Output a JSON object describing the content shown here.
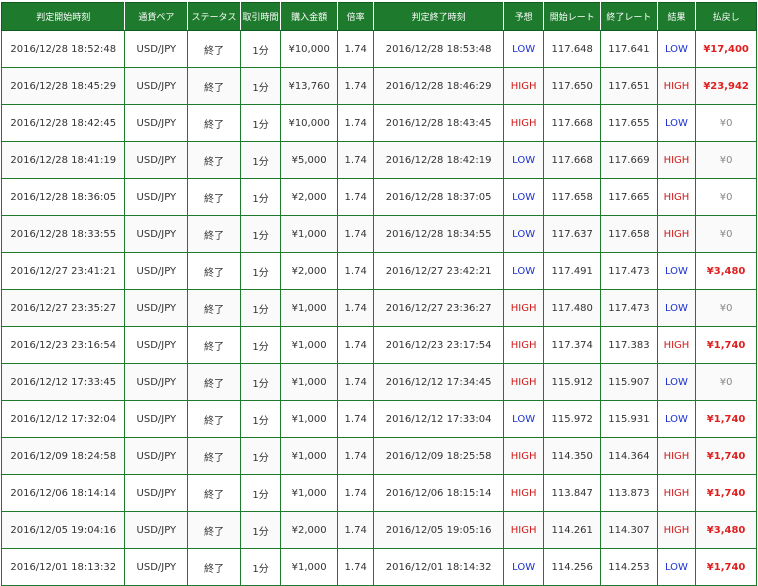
{
  "headers": [
    "判定開始時刻",
    "通貨ペア",
    "ステータス",
    "取引時間",
    "購入金額",
    "倍率",
    "判定終了時刻",
    "予想",
    "開始レート",
    "終了レート",
    "結果",
    "払戻し"
  ],
  "colors": {
    "header_bg": "#1e7a2d",
    "high": "#d11a1a",
    "low": "#1a2fd1",
    "payout_win": "#e02020",
    "payout_zero": "#888888"
  },
  "rows": [
    {
      "start": "2016/12/28 18:52:48",
      "pair": "USD/JPY",
      "status": "終了",
      "duration": "1分",
      "amount": "¥10,000",
      "rate": "1.74",
      "end": "2016/12/28 18:53:48",
      "prediction": "LOW",
      "open_rate": "117.648",
      "close_rate": "117.641",
      "result": "LOW",
      "payout": "¥17,400"
    },
    {
      "start": "2016/12/28 18:45:29",
      "pair": "USD/JPY",
      "status": "終了",
      "duration": "1分",
      "amount": "¥13,760",
      "rate": "1.74",
      "end": "2016/12/28 18:46:29",
      "prediction": "HIGH",
      "open_rate": "117.650",
      "close_rate": "117.651",
      "result": "HIGH",
      "payout": "¥23,942"
    },
    {
      "start": "2016/12/28 18:42:45",
      "pair": "USD/JPY",
      "status": "終了",
      "duration": "1分",
      "amount": "¥10,000",
      "rate": "1.74",
      "end": "2016/12/28 18:43:45",
      "prediction": "HIGH",
      "open_rate": "117.668",
      "close_rate": "117.655",
      "result": "LOW",
      "payout": "¥0"
    },
    {
      "start": "2016/12/28 18:41:19",
      "pair": "USD/JPY",
      "status": "終了",
      "duration": "1分",
      "amount": "¥5,000",
      "rate": "1.74",
      "end": "2016/12/28 18:42:19",
      "prediction": "LOW",
      "open_rate": "117.668",
      "close_rate": "117.669",
      "result": "HIGH",
      "payout": "¥0"
    },
    {
      "start": "2016/12/28 18:36:05",
      "pair": "USD/JPY",
      "status": "終了",
      "duration": "1分",
      "amount": "¥2,000",
      "rate": "1.74",
      "end": "2016/12/28 18:37:05",
      "prediction": "LOW",
      "open_rate": "117.658",
      "close_rate": "117.665",
      "result": "HIGH",
      "payout": "¥0"
    },
    {
      "start": "2016/12/28 18:33:55",
      "pair": "USD/JPY",
      "status": "終了",
      "duration": "1分",
      "amount": "¥1,000",
      "rate": "1.74",
      "end": "2016/12/28 18:34:55",
      "prediction": "LOW",
      "open_rate": "117.637",
      "close_rate": "117.658",
      "result": "HIGH",
      "payout": "¥0"
    },
    {
      "start": "2016/12/27 23:41:21",
      "pair": "USD/JPY",
      "status": "終了",
      "duration": "1分",
      "amount": "¥2,000",
      "rate": "1.74",
      "end": "2016/12/27 23:42:21",
      "prediction": "LOW",
      "open_rate": "117.491",
      "close_rate": "117.473",
      "result": "LOW",
      "payout": "¥3,480"
    },
    {
      "start": "2016/12/27 23:35:27",
      "pair": "USD/JPY",
      "status": "終了",
      "duration": "1分",
      "amount": "¥1,000",
      "rate": "1.74",
      "end": "2016/12/27 23:36:27",
      "prediction": "HIGH",
      "open_rate": "117.480",
      "close_rate": "117.473",
      "result": "LOW",
      "payout": "¥0"
    },
    {
      "start": "2016/12/23 23:16:54",
      "pair": "USD/JPY",
      "status": "終了",
      "duration": "1分",
      "amount": "¥1,000",
      "rate": "1.74",
      "end": "2016/12/23 23:17:54",
      "prediction": "HIGH",
      "open_rate": "117.374",
      "close_rate": "117.383",
      "result": "HIGH",
      "payout": "¥1,740"
    },
    {
      "start": "2016/12/12 17:33:45",
      "pair": "USD/JPY",
      "status": "終了",
      "duration": "1分",
      "amount": "¥1,000",
      "rate": "1.74",
      "end": "2016/12/12 17:34:45",
      "prediction": "HIGH",
      "open_rate": "115.912",
      "close_rate": "115.907",
      "result": "LOW",
      "payout": "¥0"
    },
    {
      "start": "2016/12/12 17:32:04",
      "pair": "USD/JPY",
      "status": "終了",
      "duration": "1分",
      "amount": "¥1,000",
      "rate": "1.74",
      "end": "2016/12/12 17:33:04",
      "prediction": "LOW",
      "open_rate": "115.972",
      "close_rate": "115.931",
      "result": "LOW",
      "payout": "¥1,740"
    },
    {
      "start": "2016/12/09 18:24:58",
      "pair": "USD/JPY",
      "status": "終了",
      "duration": "1分",
      "amount": "¥1,000",
      "rate": "1.74",
      "end": "2016/12/09 18:25:58",
      "prediction": "HIGH",
      "open_rate": "114.350",
      "close_rate": "114.364",
      "result": "HIGH",
      "payout": "¥1,740"
    },
    {
      "start": "2016/12/06 18:14:14",
      "pair": "USD/JPY",
      "status": "終了",
      "duration": "1分",
      "amount": "¥1,000",
      "rate": "1.74",
      "end": "2016/12/06 18:15:14",
      "prediction": "HIGH",
      "open_rate": "113.847",
      "close_rate": "113.873",
      "result": "HIGH",
      "payout": "¥1,740"
    },
    {
      "start": "2016/12/05 19:04:16",
      "pair": "USD/JPY",
      "status": "終了",
      "duration": "1分",
      "amount": "¥2,000",
      "rate": "1.74",
      "end": "2016/12/05 19:05:16",
      "prediction": "HIGH",
      "open_rate": "114.261",
      "close_rate": "114.307",
      "result": "HIGH",
      "payout": "¥3,480"
    },
    {
      "start": "2016/12/01 18:13:32",
      "pair": "USD/JPY",
      "status": "終了",
      "duration": "1分",
      "amount": "¥1,000",
      "rate": "1.74",
      "end": "2016/12/01 18:14:32",
      "prediction": "LOW",
      "open_rate": "114.256",
      "close_rate": "114.253",
      "result": "LOW",
      "payout": "¥1,740"
    }
  ]
}
